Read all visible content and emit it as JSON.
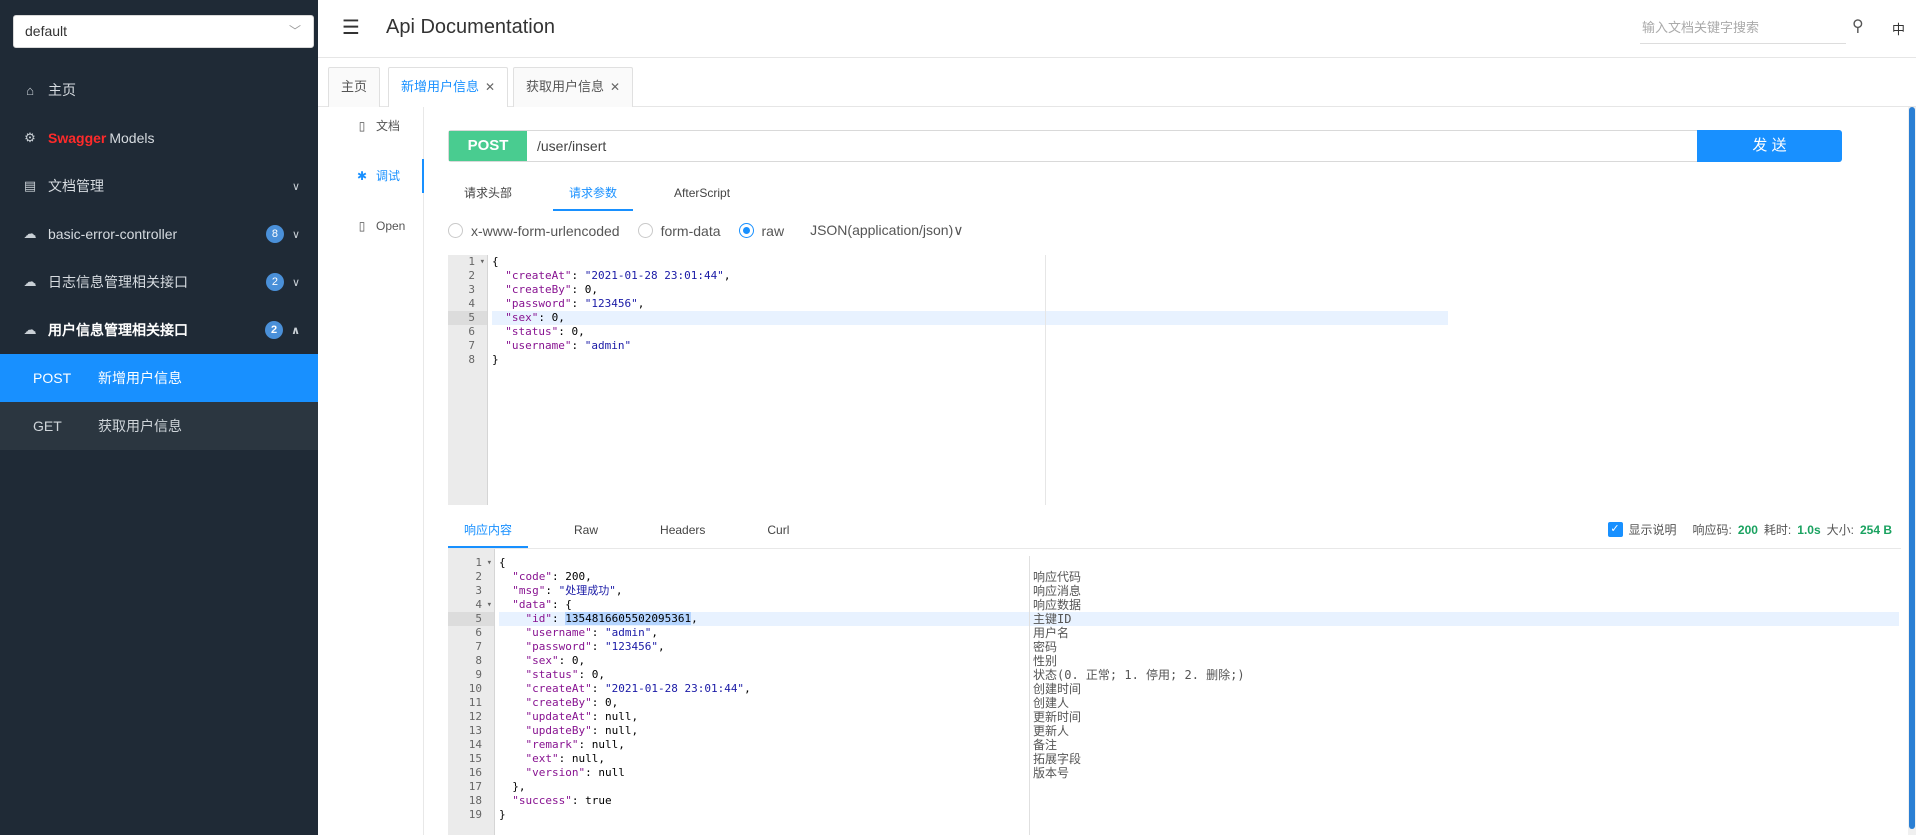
{
  "sidebar": {
    "group_select": "default",
    "caret": "﹀",
    "items": [
      {
        "icon": "home-icon",
        "label": "主页"
      },
      {
        "icon": "cube-icon",
        "label_prefix": "Swagger",
        "label": "Models"
      },
      {
        "icon": "doc-manage-icon",
        "label": "文档管理"
      },
      {
        "icon": "cloud-icon",
        "label": "basic-error-controller",
        "badge": "8"
      },
      {
        "icon": "cloud-icon",
        "label": "日志信息管理相关接口",
        "badge": "2"
      },
      {
        "icon": "cloud-icon",
        "label": "用户信息管理相关接口",
        "badge": "2"
      }
    ],
    "sub_items": [
      {
        "method": "POST",
        "label": "新增用户信息"
      },
      {
        "method": "GET",
        "label": "获取用户信息"
      }
    ]
  },
  "header": {
    "title": "Api Documentation",
    "search_placeholder": "输入文档关键字搜索",
    "lang": "中"
  },
  "tabs": [
    {
      "label": "主页"
    },
    {
      "label": "新增用户信息"
    },
    {
      "label": "获取用户信息"
    }
  ],
  "vnav": [
    {
      "label": "文档"
    },
    {
      "label": "调试"
    },
    {
      "label": "Open"
    }
  ],
  "request": {
    "method": "POST",
    "url": "/user/insert",
    "send_label": "发 送",
    "subtabs": [
      "请求头部",
      "请求参数",
      "AfterScript"
    ],
    "body_types": [
      "x-www-form-urlencoded",
      "form-data",
      "raw"
    ],
    "content_type": "JSON(application/json)",
    "body_lines": [
      "{",
      "  \"createAt\": \"2021-01-28 23:01:44\",",
      "  \"createBy\": 0,",
      "  \"password\": \"123456\",",
      "  \"sex\": 0,",
      "  \"status\": 0,",
      "  \"username\": \"admin\"",
      "}"
    ]
  },
  "response": {
    "tabs": [
      "响应内容",
      "Raw",
      "Headers",
      "Curl"
    ],
    "show_desc_label": "显示说明",
    "status_label": "响应码:",
    "status_value": "200",
    "time_label": "耗时:",
    "time_value": "1.0s",
    "size_label": "大小:",
    "size_value": "254 B",
    "lines": [
      "{",
      "  \"code\": 200,",
      "  \"msg\": \"处理成功\",",
      "  \"data\": {",
      "    \"id\": 1354816605502095361,",
      "    \"username\": \"admin\",",
      "    \"password\": \"123456\",",
      "    \"sex\": 0,",
      "    \"status\": 0,",
      "    \"createAt\": \"2021-01-28 23:01:44\",",
      "    \"createBy\": 0,",
      "    \"updateAt\": null,",
      "    \"updateBy\": null,",
      "    \"remark\": null,",
      "    \"ext\": null,",
      "    \"version\": null",
      "  },",
      "  \"success\": true",
      "}"
    ],
    "comments": [
      "",
      "响应代码",
      "响应消息",
      "响应数据",
      "主键ID",
      "用户名",
      "密码",
      "性别",
      "状态(0. 正常; 1. 停用; 2. 删除;)",
      "创建时间",
      "创建人",
      "更新时间",
      "更新人",
      "备注",
      "拓展字段",
      "版本号",
      "",
      "",
      ""
    ]
  },
  "colors": {
    "sidebar_bg": "#1f2a36",
    "active_blue": "#1890ff",
    "post_green": "#49cc90"
  }
}
